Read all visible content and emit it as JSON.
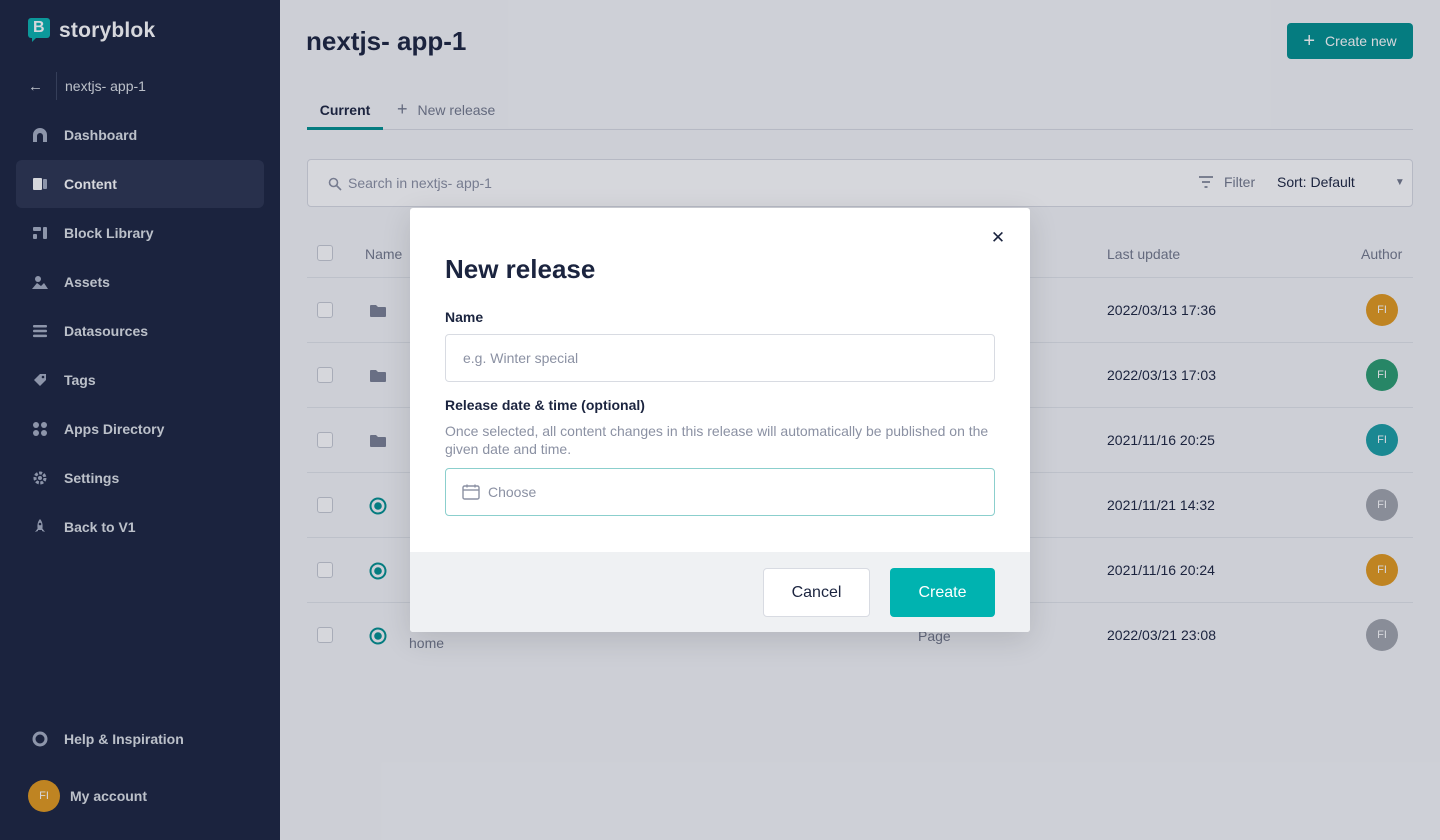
{
  "app": {
    "brand": "storyblok"
  },
  "sidebar": {
    "space_name": "nextjs- app-1",
    "items": [
      {
        "label": "Dashboard",
        "icon": "dashboard-icon"
      },
      {
        "label": "Content",
        "icon": "content-icon",
        "active": true
      },
      {
        "label": "Block Library",
        "icon": "block-library-icon"
      },
      {
        "label": "Assets",
        "icon": "assets-icon"
      },
      {
        "label": "Datasources",
        "icon": "datasources-icon"
      },
      {
        "label": "Tags",
        "icon": "tags-icon"
      },
      {
        "label": "Apps Directory",
        "icon": "apps-icon"
      },
      {
        "label": "Settings",
        "icon": "gear-icon"
      },
      {
        "label": "Back to V1",
        "icon": "rocket-icon"
      }
    ],
    "help_label": "Help & Inspiration",
    "account_label": "My account",
    "account_initials": "FI"
  },
  "header": {
    "title": "nextjs- app-1",
    "create_new_label": "Create new"
  },
  "tabs": {
    "current_label": "Current",
    "new_release_label": "New release"
  },
  "search": {
    "placeholder": "Search in nextjs- app-1",
    "filter_label": "Filter",
    "sort_label": "Sort: Default"
  },
  "table": {
    "columns": {
      "name": "Name",
      "last_update": "Last update",
      "author": "Author"
    },
    "rows": [
      {
        "kind": "folder",
        "name": "",
        "type": "",
        "last_update": "2022/03/13 17:36",
        "author": "FI",
        "author_color": "#e39a1d"
      },
      {
        "kind": "folder",
        "name": "",
        "type": "",
        "last_update": "2022/03/13 17:03",
        "author": "FI",
        "author_color": "#2a9d6f"
      },
      {
        "kind": "folder",
        "name": "",
        "type": "",
        "last_update": "2021/11/16 20:25",
        "author": "FI",
        "author_color": "#1a9fa5"
      },
      {
        "kind": "story",
        "name": "",
        "type": "",
        "last_update": "2021/11/21 14:32",
        "author": "FI",
        "author_color": "#a1a5ad"
      },
      {
        "kind": "story",
        "name": "",
        "type": "",
        "last_update": "2021/11/16 20:24",
        "author": "FI",
        "author_color": "#e39a1d"
      },
      {
        "kind": "story",
        "name": "home",
        "type": "Page",
        "last_update": "2022/03/21 23:08",
        "author": "FI",
        "author_color": "#a1a5ad"
      }
    ]
  },
  "modal": {
    "title": "New release",
    "name_label": "Name",
    "name_placeholder": "e.g. Winter special",
    "date_label": "Release date & time (optional)",
    "date_hint": "Once selected, all content changes in this release will automatically be published on the given date and time.",
    "date_placeholder": "Choose",
    "cancel_label": "Cancel",
    "create_label": "Create"
  },
  "colors": {
    "sidebar_bg": "#1b243f",
    "accent": "#00918f",
    "create_button": "#00b3b0"
  }
}
